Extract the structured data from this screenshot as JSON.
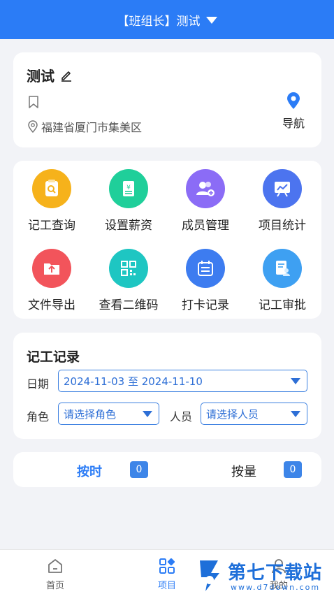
{
  "header": {
    "title": "【班组长】测试"
  },
  "project": {
    "name": "测试",
    "address": "福建省厦门市集美区",
    "nav_label": "导航"
  },
  "menu": {
    "items": [
      {
        "label": "记工查询",
        "icon": "search-doc-icon",
        "color": "#f6b21b"
      },
      {
        "label": "设置薪资",
        "icon": "salary-icon",
        "color": "#1fcf9a"
      },
      {
        "label": "成员管理",
        "icon": "members-icon",
        "color": "#8b6cf6"
      },
      {
        "label": "项目统计",
        "icon": "chart-board-icon",
        "color": "#4c74ef"
      },
      {
        "label": "文件导出",
        "icon": "folder-upload-icon",
        "color": "#f2545b"
      },
      {
        "label": "查看二维码",
        "icon": "qrcode-icon",
        "color": "#1ec6c2"
      },
      {
        "label": "打卡记录",
        "icon": "calendar-icon",
        "color": "#3d7cf0"
      },
      {
        "label": "记工审批",
        "icon": "approval-icon",
        "color": "#3ea0f2"
      }
    ]
  },
  "record": {
    "title": "记工记录",
    "date_label": "日期",
    "date_value": "2024-11-03 至 2024-11-10",
    "role_label": "角色",
    "role_placeholder": "请选择角色",
    "person_label": "人员",
    "person_placeholder": "请选择人员"
  },
  "stats": {
    "by_time_label": "按时",
    "by_time_count": "0",
    "by_quantity_label": "按量",
    "by_quantity_count": "0"
  },
  "tabbar": {
    "home": "首页",
    "project": "项目",
    "mine": "我的"
  },
  "watermark": {
    "text": "第七下载站",
    "url": "www.d7down.com"
  },
  "colors": {
    "primary": "#2b7cf6"
  }
}
